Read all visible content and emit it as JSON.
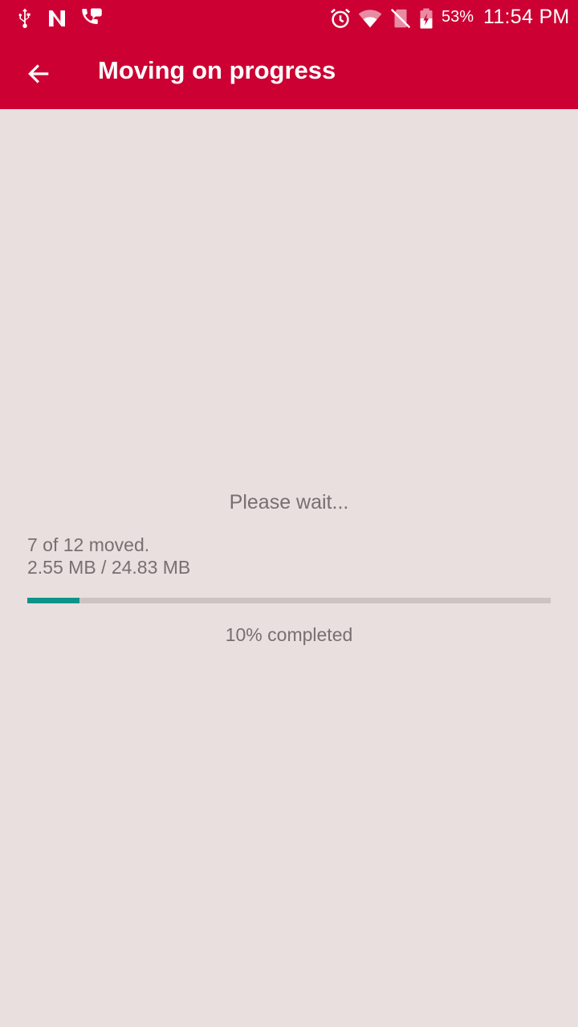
{
  "status_bar": {
    "battery_percent": "53%",
    "time": "11:54 PM",
    "icons": [
      "usb-icon",
      "n-app-icon",
      "phone-chat-icon",
      "alarm-icon",
      "wifi-icon",
      "no-sim-icon",
      "battery-charging-icon"
    ]
  },
  "app_bar": {
    "title": "Moving on progress",
    "back_icon": "arrow-left-icon"
  },
  "progress": {
    "status_text": "Please wait...",
    "moved_text": "7 of 12 moved.",
    "size_text": "2.55 MB / 24.83 MB",
    "percent": 10,
    "percent_label": "10%",
    "completed_suffix": " completed"
  },
  "colors": {
    "primary": "#cc0033",
    "background": "#e9dfdf",
    "progress_fill": "#0d9488",
    "progress_track": "#cdc3c3",
    "text_secondary": "#7a6e70"
  }
}
